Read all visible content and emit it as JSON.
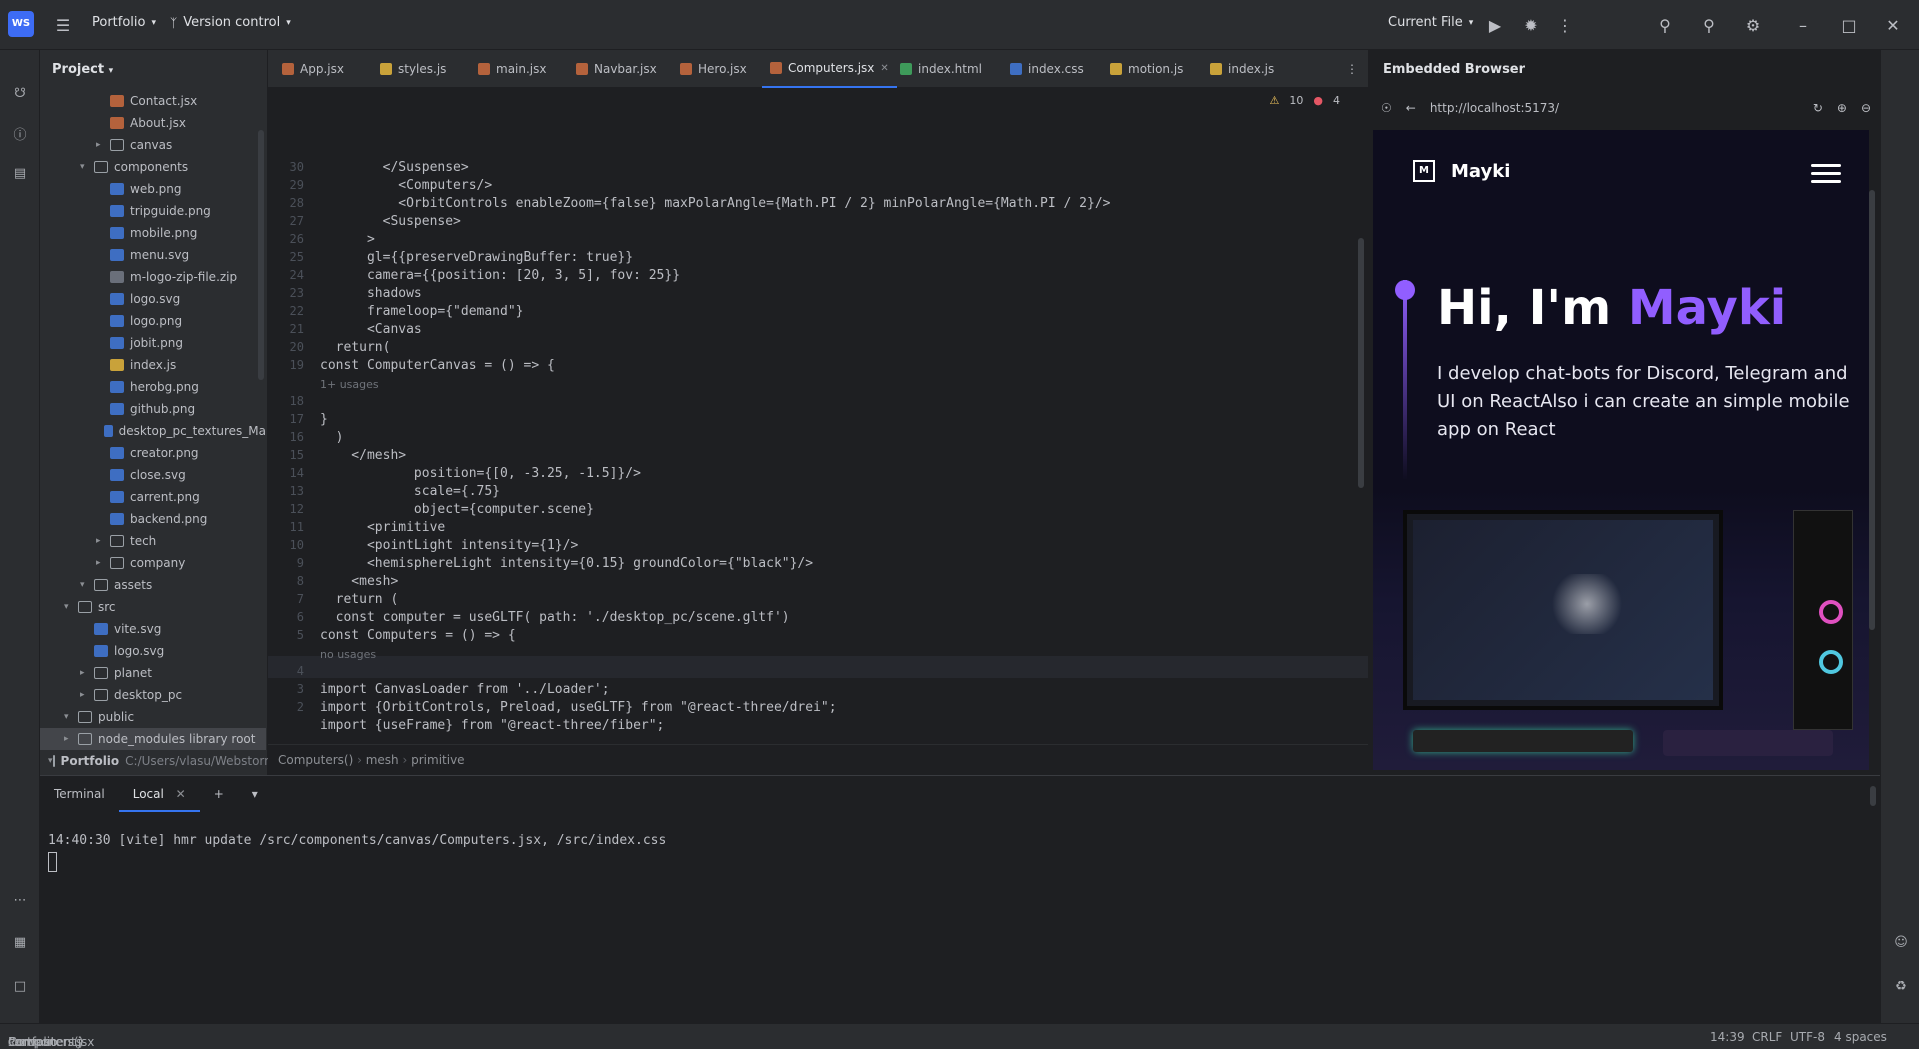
{
  "titlebar": {
    "logo": "WS",
    "project": "Portfolio",
    "vcs": "Version control",
    "run_config": "Current File"
  },
  "project_panel": {
    "title": "Project",
    "items": [
      {
        "label": "Portfolio",
        "suffix": "C:/Users/vlasu/Webstorm",
        "type": "folder",
        "depth": 0,
        "open": true
      },
      {
        "label": "node_modules library root",
        "type": "folder",
        "depth": 1,
        "open": false,
        "selected": true
      },
      {
        "label": "public",
        "type": "folder",
        "depth": 1,
        "open": true
      },
      {
        "label": "desktop_pc",
        "type": "folder",
        "depth": 2,
        "open": false
      },
      {
        "label": "planet",
        "type": "folder",
        "depth": 2,
        "open": false
      },
      {
        "label": "logo.svg",
        "type": "img",
        "depth": 2
      },
      {
        "label": "vite.svg",
        "type": "img",
        "depth": 2
      },
      {
        "label": "src",
        "type": "folder",
        "depth": 1,
        "open": true
      },
      {
        "label": "assets",
        "type": "folder",
        "depth": 2,
        "open": true
      },
      {
        "label": "company",
        "type": "folder",
        "depth": 3,
        "open": false
      },
      {
        "label": "tech",
        "type": "folder",
        "depth": 3,
        "open": false
      },
      {
        "label": "backend.png",
        "type": "img",
        "depth": 3
      },
      {
        "label": "carrent.png",
        "type": "img",
        "depth": 3
      },
      {
        "label": "close.svg",
        "type": "img",
        "depth": 3
      },
      {
        "label": "creator.png",
        "type": "img",
        "depth": 3
      },
      {
        "label": "desktop_pc_textures_Ma",
        "type": "img",
        "depth": 3
      },
      {
        "label": "github.png",
        "type": "img",
        "depth": 3
      },
      {
        "label": "herobg.png",
        "type": "img",
        "depth": 3
      },
      {
        "label": "index.js",
        "type": "js",
        "depth": 3
      },
      {
        "label": "jobit.png",
        "type": "img",
        "depth": 3
      },
      {
        "label": "logo.png",
        "type": "img",
        "depth": 3
      },
      {
        "label": "logo.svg",
        "type": "img",
        "depth": 3
      },
      {
        "label": "m-logo-zip-file.zip",
        "type": "zip",
        "depth": 3
      },
      {
        "label": "menu.svg",
        "type": "img",
        "depth": 3
      },
      {
        "label": "mobile.png",
        "type": "img",
        "depth": 3
      },
      {
        "label": "tripguide.png",
        "type": "img",
        "depth": 3
      },
      {
        "label": "web.png",
        "type": "img",
        "depth": 3
      },
      {
        "label": "components",
        "type": "folder",
        "depth": 2,
        "open": true
      },
      {
        "label": "canvas",
        "type": "folder",
        "depth": 3,
        "open": false
      },
      {
        "label": "About.jsx",
        "type": "jsx",
        "depth": 3
      },
      {
        "label": "Contact.jsx",
        "type": "jsx",
        "depth": 3
      }
    ]
  },
  "editor_tabs": [
    {
      "label": "App.jsx",
      "type": "jsx"
    },
    {
      "label": "styles.js",
      "type": "js"
    },
    {
      "label": "main.jsx",
      "type": "jsx"
    },
    {
      "label": "Navbar.jsx",
      "type": "jsx"
    },
    {
      "label": "Hero.jsx",
      "type": "jsx"
    },
    {
      "label": "Computers.jsx",
      "type": "jsx",
      "active": true
    },
    {
      "label": "index.html",
      "type": "html"
    },
    {
      "label": "index.css",
      "type": "css"
    },
    {
      "label": "motion.js",
      "type": "js"
    },
    {
      "label": "index.js",
      "type": "js"
    }
  ],
  "editor": {
    "warnings": "10",
    "errors": "4",
    "lines": [
      {
        "n": "",
        "text": "import {useFrame} from \"@react-three/fiber\";"
      },
      {
        "n": "2",
        "text": "import {OrbitControls, Preload, useGLTF} from \"@react-three/drei\";"
      },
      {
        "n": "3",
        "text": "import CanvasLoader from '../Loader';"
      },
      {
        "n": "4",
        "text": ""
      },
      {
        "n": "",
        "hint": "no usages"
      },
      {
        "n": "5",
        "text": "const Computers = () => {"
      },
      {
        "n": "6",
        "text": "  const computer = useGLTF( path: './desktop_pc/scene.gltf')"
      },
      {
        "n": "7",
        "text": "  return ("
      },
      {
        "n": "8",
        "text": "    <mesh>"
      },
      {
        "n": "9",
        "text": "      <hemisphereLight intensity={0.15} groundColor={\"black\"}/>"
      },
      {
        "n": "10",
        "text": "      <pointLight intensity={1}/>"
      },
      {
        "n": "11",
        "text": "      <primitive"
      },
      {
        "n": "12",
        "text": "            object={computer.scene}"
      },
      {
        "n": "13",
        "text": "            scale={.75}"
      },
      {
        "n": "14",
        "text": "            position={[0, -3.25, -1.5]}/>"
      },
      {
        "n": "15",
        "text": "    </mesh>"
      },
      {
        "n": "16",
        "text": "  )"
      },
      {
        "n": "17",
        "text": "}"
      },
      {
        "n": "18",
        "text": ""
      },
      {
        "n": "",
        "hint": "1+ usages"
      },
      {
        "n": "19",
        "text": "const ComputerCanvas = () => {"
      },
      {
        "n": "20",
        "text": "  return("
      },
      {
        "n": "21",
        "text": "      <Canvas"
      },
      {
        "n": "22",
        "text": "      frameloop={\"demand\"}"
      },
      {
        "n": "23",
        "text": "      shadows"
      },
      {
        "n": "24",
        "text": "      camera={{position: [20, 3, 5], fov: 25}}"
      },
      {
        "n": "25",
        "text": "      gl={{preserveDrawingBuffer: true}}"
      },
      {
        "n": "26",
        "text": "      >"
      },
      {
        "n": "27",
        "text": "        <Suspense>"
      },
      {
        "n": "28",
        "text": "          <OrbitControls enableZoom={false} maxPolarAngle={Math.PI / 2} minPolarAngle={Math.PI / 2}/>"
      },
      {
        "n": "29",
        "text": "          <Computers/>"
      },
      {
        "n": "30",
        "text": "        </Suspense>"
      }
    ],
    "code_breadcrumb": [
      "Computers()",
      "mesh",
      "primitive"
    ]
  },
  "browser": {
    "title": "Embedded Browser",
    "url": "http://localhost:5173/",
    "site": {
      "brand": "Mayki",
      "hero_prefix": "Hi, I'm ",
      "hero_name": "Mayki",
      "hero_sub": "I develop chat-bots for Discord, Telegram and UI on ReactAlso i can create an simple mobile app on React"
    }
  },
  "terminal": {
    "tabs": [
      "Terminal",
      "Local"
    ],
    "line": "14:40:30 [vite] hmr update /src/components/canvas/Computers.jsx, /src/index.css"
  },
  "statusbar": {
    "breadcrumb": [
      "Portfolio",
      "src",
      "components",
      "canvas",
      "Computers.jsx",
      "Computers()"
    ],
    "position": "14:39",
    "line_sep": "CRLF",
    "encoding": "UTF-8",
    "indent": "4 spaces"
  },
  "colors": {
    "accent": "#3574f0",
    "brand": "#915eff"
  }
}
